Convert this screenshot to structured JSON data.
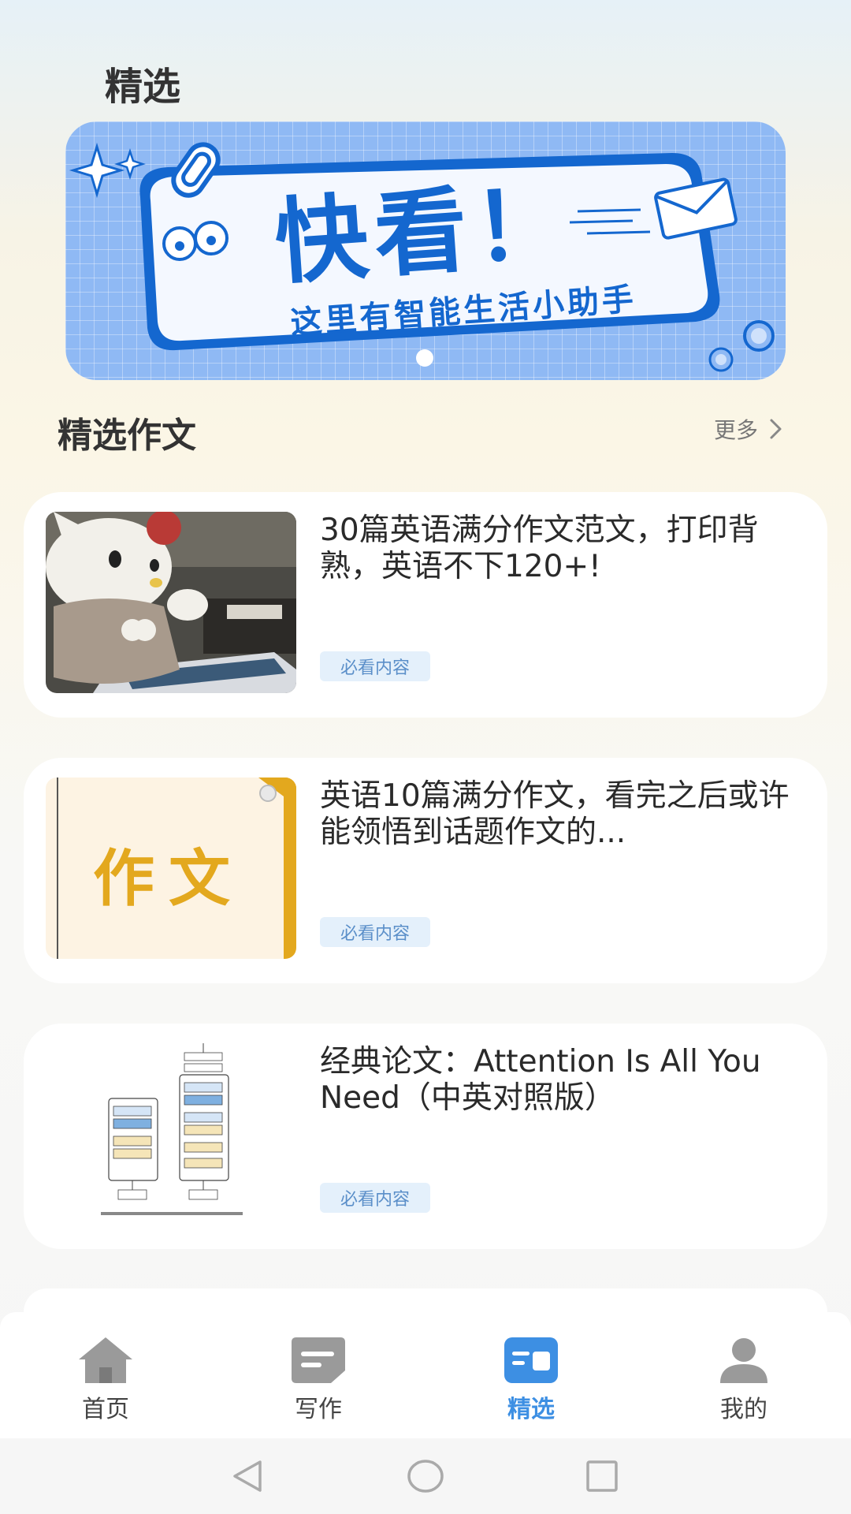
{
  "header": {
    "title": "精选"
  },
  "banner": {
    "headline": "快看！",
    "subline": "这里有智能生活小助手"
  },
  "section": {
    "title": "精选作文",
    "more_label": "更多"
  },
  "articles": [
    {
      "title": "30篇英语满分作文范文，打印背熟，英语不下120+!",
      "tag": "必看内容",
      "thumb": "hello-kitty-photo"
    },
    {
      "title": "英语10篇满分作文，看完之后或许能领悟到话题作文的...",
      "tag": "必看内容",
      "thumb_text": "作文"
    },
    {
      "title": "经典论文：Attention Is All You Need（中英对照版）",
      "tag": "必看内容",
      "thumb": "transformer-diagram"
    }
  ],
  "tabs": [
    {
      "label": "首页",
      "icon": "home-icon",
      "active": false
    },
    {
      "label": "写作",
      "icon": "write-icon",
      "active": false
    },
    {
      "label": "精选",
      "icon": "featured-icon",
      "active": true
    },
    {
      "label": "我的",
      "icon": "user-icon",
      "active": false
    }
  ],
  "colors": {
    "accent": "#3d8fe3",
    "banner_blue": "#1467cf",
    "tag_bg": "#e4f0fb"
  }
}
